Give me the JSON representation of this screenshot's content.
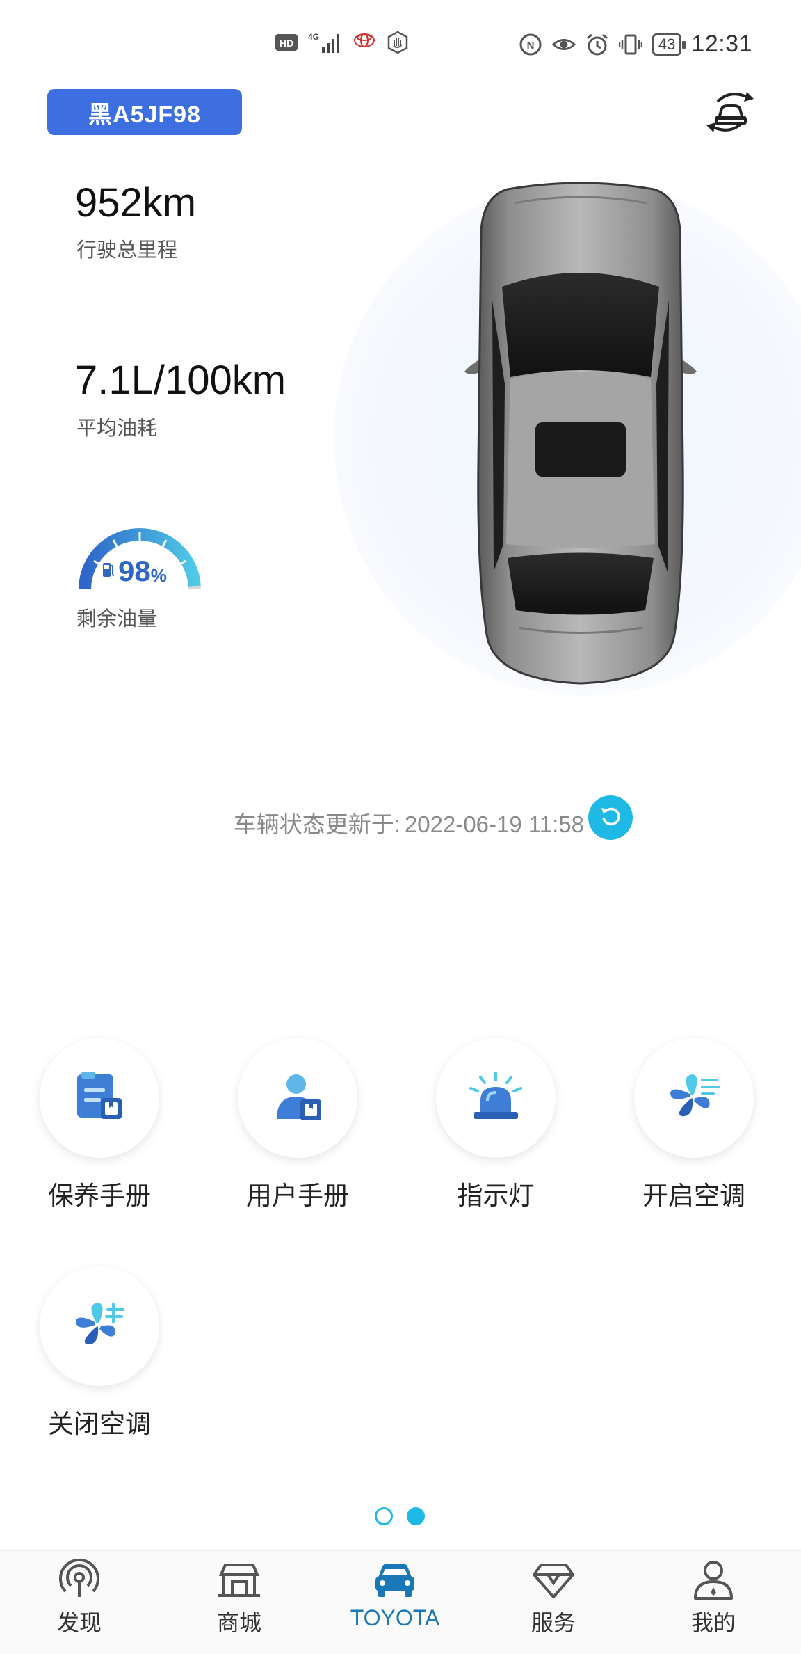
{
  "status_bar": {
    "time": "12:31",
    "battery": "43",
    "left_icons": [
      "hd-icon",
      "signal-4g-icon",
      "toyota-logo-icon",
      "hand-icon"
    ],
    "right_icons": [
      "nfc-icon",
      "eye-icon",
      "alarm-icon",
      "vibrate-icon"
    ]
  },
  "vehicle": {
    "plate": "黑A5JF98"
  },
  "stats": {
    "mileage_value": "952km",
    "mileage_label": "行驶总里程",
    "fuel_consumption_value": "7.1L/100km",
    "fuel_consumption_label": "平均油耗",
    "fuel_level_value": "98",
    "fuel_level_unit": "%",
    "fuel_level_label": "剩余油量",
    "fuel_level_fraction": 0.98
  },
  "update": {
    "label": "车辆状态更新于:",
    "timestamp": "2022-06-19 11:58"
  },
  "functions": [
    {
      "label": "保养手册",
      "icon": "maintenance-manual-icon"
    },
    {
      "label": "用户手册",
      "icon": "user-manual-icon"
    },
    {
      "label": "指示灯",
      "icon": "indicator-light-icon"
    },
    {
      "label": "开启空调",
      "icon": "ac-on-icon"
    },
    {
      "label": "关闭空调",
      "icon": "ac-off-icon"
    }
  ],
  "pagination": {
    "total": 2,
    "current": 2
  },
  "bottom_nav": [
    {
      "label": "发现",
      "icon": "discover-icon",
      "active": false
    },
    {
      "label": "商城",
      "icon": "shop-icon",
      "active": false
    },
    {
      "label": "TOYOTA",
      "icon": "car-icon",
      "active": true
    },
    {
      "label": "服务",
      "icon": "diamond-icon",
      "active": false
    },
    {
      "label": "我的",
      "icon": "profile-icon",
      "active": false
    }
  ],
  "colors": {
    "accent": "#1fb9e6",
    "plate_bg": "#3e6fe0",
    "nav_active": "#1a78b8",
    "gauge_dark": "#2f66c9",
    "gauge_light": "#4fc9e6"
  }
}
